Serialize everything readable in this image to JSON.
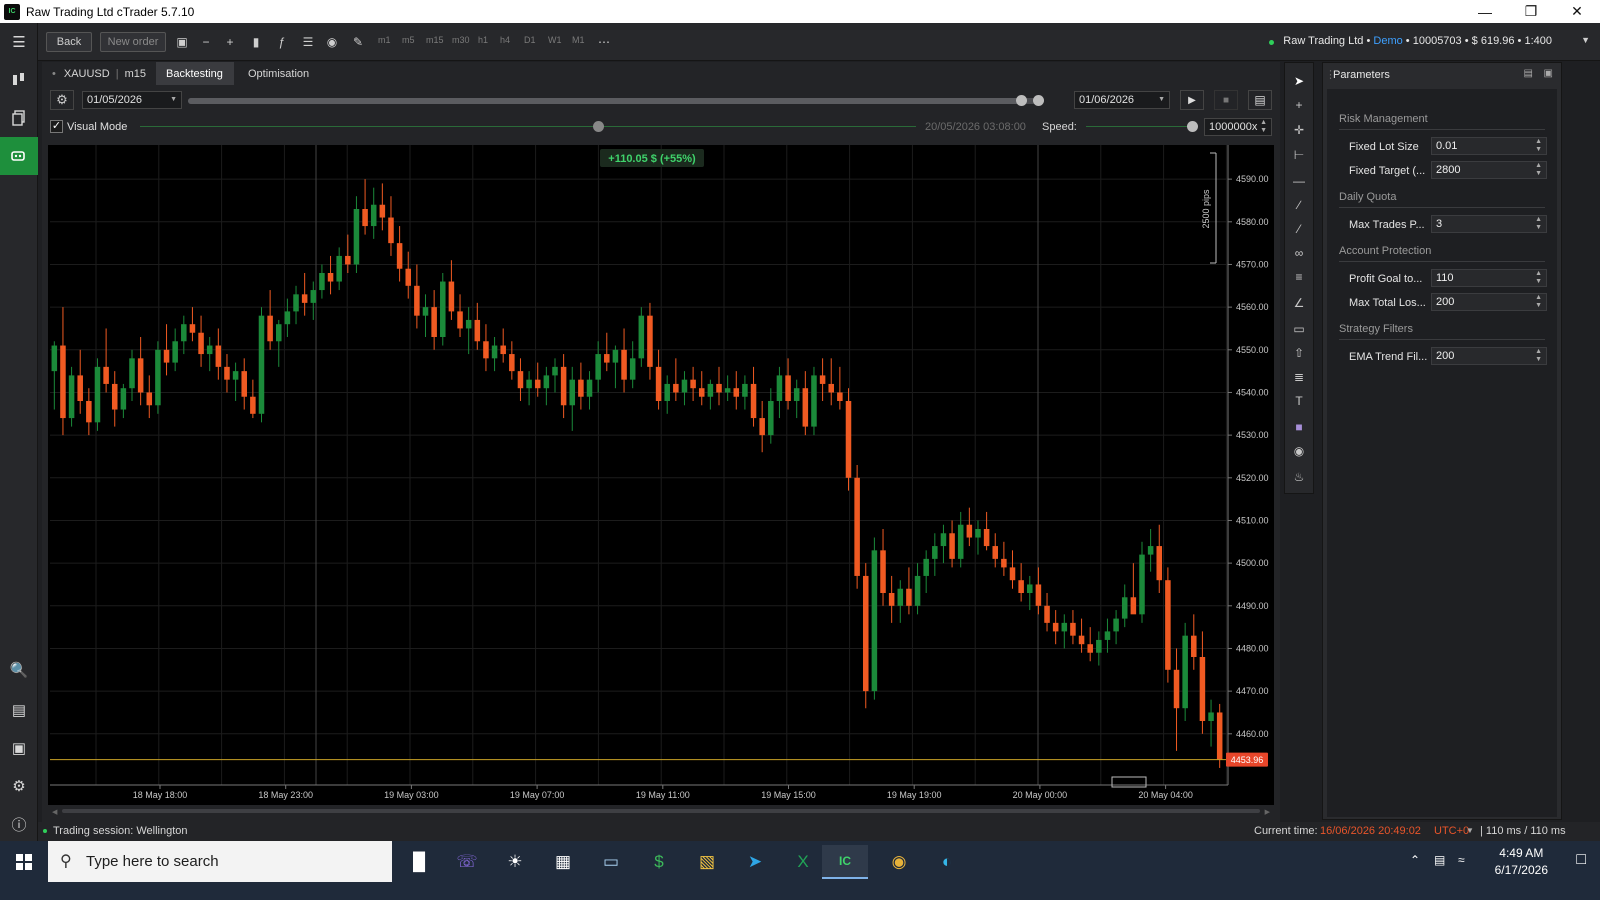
{
  "window": {
    "title": "Raw Trading Ltd cTrader 5.7.10",
    "app_icon_text": "IC"
  },
  "toolbar": {
    "back_label": "Back",
    "new_order_label": "New order",
    "timeframes": [
      "m1",
      "m5",
      "m15",
      "m30",
      "h1",
      "h4",
      "D1",
      "W1",
      "M1"
    ],
    "account": {
      "broker": "Raw Trading Ltd",
      "separator": "•",
      "type": "Demo",
      "number": "10005703",
      "balance": "$ 619.96",
      "leverage": "1:400"
    }
  },
  "tabs": {
    "symbol": "XAUUSD",
    "timeframe": "m15",
    "backtesting": "Backtesting",
    "optimisation": "Optimisation"
  },
  "backtest": {
    "start_date": "01/05/2026",
    "end_date": "01/06/2026",
    "visual_mode_label": "Visual Mode",
    "visual_mode_checked": true,
    "current_sim_time": "20/05/2026 03:08:00",
    "speed_label": "Speed:",
    "speed_value": "1000000x",
    "progress": 0.98,
    "visual_progress": 0.59
  },
  "chart_data": {
    "type": "candlestick",
    "symbol": "XAUUSD",
    "timeframe": "m15",
    "pnl_badge": "+110.05 $ (+55%)",
    "ruler_label": "2500 pips",
    "current_price": "4453.96",
    "ylim": [
      4448,
      4598
    ],
    "y_ticks": [
      "4590.00",
      "4580.00",
      "4570.00",
      "4560.00",
      "4550.00",
      "4540.00",
      "4530.00",
      "4520.00",
      "4510.00",
      "4500.00",
      "4490.00",
      "4480.00",
      "4470.00",
      "4460.00"
    ],
    "x_ticks": [
      "18 May 18:00",
      "18 May 23:00",
      "19 May 03:00",
      "19 May 07:00",
      "19 May 11:00",
      "19 May 15:00",
      "19 May 19:00",
      "20 May 00:00",
      "20 May 04:00"
    ],
    "colors": {
      "up": "#1b8a3a",
      "down": "#f05a22",
      "background": "#000000",
      "price_line": "#c9a227"
    },
    "candles": [
      {
        "o": 4545,
        "h": 4552,
        "l": 4536,
        "c": 4551
      },
      {
        "o": 4551,
        "h": 4560,
        "l": 4530,
        "c": 4534
      },
      {
        "o": 4534,
        "h": 4546,
        "l": 4532,
        "c": 4544
      },
      {
        "o": 4544,
        "h": 4550,
        "l": 4535,
        "c": 4538
      },
      {
        "o": 4538,
        "h": 4541,
        "l": 4530,
        "c": 4533
      },
      {
        "o": 4533,
        "h": 4548,
        "l": 4531,
        "c": 4546
      },
      {
        "o": 4546,
        "h": 4555,
        "l": 4540,
        "c": 4542
      },
      {
        "o": 4542,
        "h": 4545,
        "l": 4532,
        "c": 4536
      },
      {
        "o": 4536,
        "h": 4542,
        "l": 4534,
        "c": 4541
      },
      {
        "o": 4541,
        "h": 4550,
        "l": 4538,
        "c": 4548
      },
      {
        "o": 4548,
        "h": 4553,
        "l": 4537,
        "c": 4540
      },
      {
        "o": 4540,
        "h": 4544,
        "l": 4534,
        "c": 4537
      },
      {
        "o": 4537,
        "h": 4552,
        "l": 4535,
        "c": 4550
      },
      {
        "o": 4550,
        "h": 4556,
        "l": 4544,
        "c": 4547
      },
      {
        "o": 4547,
        "h": 4555,
        "l": 4545,
        "c": 4552
      },
      {
        "o": 4552,
        "h": 4558,
        "l": 4549,
        "c": 4556
      },
      {
        "o": 4556,
        "h": 4560,
        "l": 4552,
        "c": 4554
      },
      {
        "o": 4554,
        "h": 4558,
        "l": 4546,
        "c": 4549
      },
      {
        "o": 4549,
        "h": 4553,
        "l": 4545,
        "c": 4551
      },
      {
        "o": 4551,
        "h": 4555,
        "l": 4543,
        "c": 4546
      },
      {
        "o": 4546,
        "h": 4549,
        "l": 4540,
        "c": 4543
      },
      {
        "o": 4543,
        "h": 4547,
        "l": 4538,
        "c": 4545
      },
      {
        "o": 4545,
        "h": 4548,
        "l": 4536,
        "c": 4539
      },
      {
        "o": 4539,
        "h": 4543,
        "l": 4534,
        "c": 4535
      },
      {
        "o": 4535,
        "h": 4560,
        "l": 4533,
        "c": 4558
      },
      {
        "o": 4558,
        "h": 4564,
        "l": 4550,
        "c": 4552
      },
      {
        "o": 4552,
        "h": 4557,
        "l": 4546,
        "c": 4556
      },
      {
        "o": 4556,
        "h": 4562,
        "l": 4553,
        "c": 4559
      },
      {
        "o": 4559,
        "h": 4565,
        "l": 4556,
        "c": 4563
      },
      {
        "o": 4563,
        "h": 4568,
        "l": 4558,
        "c": 4561
      },
      {
        "o": 4561,
        "h": 4566,
        "l": 4557,
        "c": 4564
      },
      {
        "o": 4564,
        "h": 4570,
        "l": 4562,
        "c": 4568
      },
      {
        "o": 4568,
        "h": 4572,
        "l": 4563,
        "c": 4566
      },
      {
        "o": 4566,
        "h": 4574,
        "l": 4564,
        "c": 4572
      },
      {
        "o": 4572,
        "h": 4577,
        "l": 4568,
        "c": 4570
      },
      {
        "o": 4570,
        "h": 4586,
        "l": 4568,
        "c": 4583
      },
      {
        "o": 4583,
        "h": 4590,
        "l": 4577,
        "c": 4579
      },
      {
        "o": 4579,
        "h": 4588,
        "l": 4576,
        "c": 4584
      },
      {
        "o": 4584,
        "h": 4589,
        "l": 4578,
        "c": 4581
      },
      {
        "o": 4581,
        "h": 4586,
        "l": 4572,
        "c": 4575
      },
      {
        "o": 4575,
        "h": 4579,
        "l": 4566,
        "c": 4569
      },
      {
        "o": 4569,
        "h": 4573,
        "l": 4562,
        "c": 4565
      },
      {
        "o": 4565,
        "h": 4570,
        "l": 4555,
        "c": 4558
      },
      {
        "o": 4558,
        "h": 4563,
        "l": 4553,
        "c": 4560
      },
      {
        "o": 4560,
        "h": 4564,
        "l": 4550,
        "c": 4553
      },
      {
        "o": 4553,
        "h": 4568,
        "l": 4551,
        "c": 4566
      },
      {
        "o": 4566,
        "h": 4571,
        "l": 4557,
        "c": 4559
      },
      {
        "o": 4559,
        "h": 4563,
        "l": 4553,
        "c": 4555
      },
      {
        "o": 4555,
        "h": 4560,
        "l": 4549,
        "c": 4557
      },
      {
        "o": 4557,
        "h": 4561,
        "l": 4550,
        "c": 4552
      },
      {
        "o": 4552,
        "h": 4556,
        "l": 4545,
        "c": 4548
      },
      {
        "o": 4548,
        "h": 4553,
        "l": 4545,
        "c": 4551
      },
      {
        "o": 4551,
        "h": 4555,
        "l": 4547,
        "c": 4549
      },
      {
        "o": 4549,
        "h": 4552,
        "l": 4543,
        "c": 4545
      },
      {
        "o": 4545,
        "h": 4548,
        "l": 4538,
        "c": 4541
      },
      {
        "o": 4541,
        "h": 4545,
        "l": 4537,
        "c": 4543
      },
      {
        "o": 4543,
        "h": 4547,
        "l": 4539,
        "c": 4541
      },
      {
        "o": 4541,
        "h": 4546,
        "l": 4537,
        "c": 4544
      },
      {
        "o": 4544,
        "h": 4548,
        "l": 4540,
        "c": 4546
      },
      {
        "o": 4546,
        "h": 4549,
        "l": 4534,
        "c": 4537
      },
      {
        "o": 4537,
        "h": 4546,
        "l": 4531,
        "c": 4543
      },
      {
        "o": 4543,
        "h": 4547,
        "l": 4536,
        "c": 4539
      },
      {
        "o": 4539,
        "h": 4545,
        "l": 4536,
        "c": 4543
      },
      {
        "o": 4543,
        "h": 4552,
        "l": 4540,
        "c": 4549
      },
      {
        "o": 4549,
        "h": 4554,
        "l": 4545,
        "c": 4547
      },
      {
        "o": 4547,
        "h": 4551,
        "l": 4541,
        "c": 4550
      },
      {
        "o": 4550,
        "h": 4555,
        "l": 4540,
        "c": 4543
      },
      {
        "o": 4543,
        "h": 4552,
        "l": 4541,
        "c": 4548
      },
      {
        "o": 4548,
        "h": 4560,
        "l": 4546,
        "c": 4558
      },
      {
        "o": 4558,
        "h": 4561,
        "l": 4543,
        "c": 4546
      },
      {
        "o": 4546,
        "h": 4550,
        "l": 4536,
        "c": 4538
      },
      {
        "o": 4538,
        "h": 4544,
        "l": 4535,
        "c": 4542
      },
      {
        "o": 4542,
        "h": 4548,
        "l": 4538,
        "c": 4540
      },
      {
        "o": 4540,
        "h": 4545,
        "l": 4537,
        "c": 4543
      },
      {
        "o": 4543,
        "h": 4546,
        "l": 4538,
        "c": 4541
      },
      {
        "o": 4541,
        "h": 4545,
        "l": 4537,
        "c": 4539
      },
      {
        "o": 4539,
        "h": 4543,
        "l": 4536,
        "c": 4542
      },
      {
        "o": 4542,
        "h": 4546,
        "l": 4537,
        "c": 4540
      },
      {
        "o": 4540,
        "h": 4544,
        "l": 4538,
        "c": 4541
      },
      {
        "o": 4541,
        "h": 4545,
        "l": 4536,
        "c": 4539
      },
      {
        "o": 4539,
        "h": 4544,
        "l": 4536,
        "c": 4542
      },
      {
        "o": 4542,
        "h": 4546,
        "l": 4532,
        "c": 4534
      },
      {
        "o": 4534,
        "h": 4538,
        "l": 4526,
        "c": 4530
      },
      {
        "o": 4530,
        "h": 4541,
        "l": 4528,
        "c": 4538
      },
      {
        "o": 4538,
        "h": 4546,
        "l": 4534,
        "c": 4544
      },
      {
        "o": 4544,
        "h": 4548,
        "l": 4536,
        "c": 4538
      },
      {
        "o": 4538,
        "h": 4543,
        "l": 4534,
        "c": 4541
      },
      {
        "o": 4541,
        "h": 4545,
        "l": 4530,
        "c": 4532
      },
      {
        "o": 4532,
        "h": 4546,
        "l": 4530,
        "c": 4544
      },
      {
        "o": 4544,
        "h": 4548,
        "l": 4538,
        "c": 4542
      },
      {
        "o": 4542,
        "h": 4548,
        "l": 4537,
        "c": 4540
      },
      {
        "o": 4540,
        "h": 4546,
        "l": 4536,
        "c": 4538
      },
      {
        "o": 4538,
        "h": 4541,
        "l": 4517,
        "c": 4520
      },
      {
        "o": 4520,
        "h": 4523,
        "l": 4494,
        "c": 4497
      },
      {
        "o": 4497,
        "h": 4500,
        "l": 4466,
        "c": 4470
      },
      {
        "o": 4470,
        "h": 4506,
        "l": 4468,
        "c": 4503
      },
      {
        "o": 4503,
        "h": 4508,
        "l": 4490,
        "c": 4493
      },
      {
        "o": 4493,
        "h": 4497,
        "l": 4486,
        "c": 4490
      },
      {
        "o": 4490,
        "h": 4496,
        "l": 4486,
        "c": 4494
      },
      {
        "o": 4494,
        "h": 4499,
        "l": 4488,
        "c": 4490
      },
      {
        "o": 4490,
        "h": 4500,
        "l": 4488,
        "c": 4497
      },
      {
        "o": 4497,
        "h": 4503,
        "l": 4493,
        "c": 4501
      },
      {
        "o": 4501,
        "h": 4507,
        "l": 4497,
        "c": 4504
      },
      {
        "o": 4504,
        "h": 4509,
        "l": 4500,
        "c": 4507
      },
      {
        "o": 4507,
        "h": 4510,
        "l": 4499,
        "c": 4501
      },
      {
        "o": 4501,
        "h": 4512,
        "l": 4499,
        "c": 4509
      },
      {
        "o": 4509,
        "h": 4513,
        "l": 4504,
        "c": 4506
      },
      {
        "o": 4506,
        "h": 4510,
        "l": 4502,
        "c": 4508
      },
      {
        "o": 4508,
        "h": 4512,
        "l": 4503,
        "c": 4504
      },
      {
        "o": 4504,
        "h": 4507,
        "l": 4499,
        "c": 4501
      },
      {
        "o": 4501,
        "h": 4505,
        "l": 4497,
        "c": 4499
      },
      {
        "o": 4499,
        "h": 4503,
        "l": 4494,
        "c": 4496
      },
      {
        "o": 4496,
        "h": 4500,
        "l": 4491,
        "c": 4493
      },
      {
        "o": 4493,
        "h": 4497,
        "l": 4489,
        "c": 4495
      },
      {
        "o": 4495,
        "h": 4499,
        "l": 4488,
        "c": 4490
      },
      {
        "o": 4490,
        "h": 4493,
        "l": 4484,
        "c": 4486
      },
      {
        "o": 4486,
        "h": 4489,
        "l": 4481,
        "c": 4484
      },
      {
        "o": 4484,
        "h": 4488,
        "l": 4480,
        "c": 4486
      },
      {
        "o": 4486,
        "h": 4489,
        "l": 4481,
        "c": 4483
      },
      {
        "o": 4483,
        "h": 4487,
        "l": 4479,
        "c": 4481
      },
      {
        "o": 4481,
        "h": 4485,
        "l": 4477,
        "c": 4479
      },
      {
        "o": 4479,
        "h": 4484,
        "l": 4476,
        "c": 4482
      },
      {
        "o": 4482,
        "h": 4487,
        "l": 4479,
        "c": 4484
      },
      {
        "o": 4484,
        "h": 4489,
        "l": 4481,
        "c": 4487
      },
      {
        "o": 4487,
        "h": 4495,
        "l": 4485,
        "c": 4492
      },
      {
        "o": 4492,
        "h": 4500,
        "l": 4490,
        "c": 4488
      },
      {
        "o": 4488,
        "h": 4505,
        "l": 4486,
        "c": 4502
      },
      {
        "o": 4502,
        "h": 4508,
        "l": 4498,
        "c": 4504
      },
      {
        "o": 4504,
        "h": 4509,
        "l": 4493,
        "c": 4496
      },
      {
        "o": 4496,
        "h": 4499,
        "l": 4472,
        "c": 4475
      },
      {
        "o": 4475,
        "h": 4480,
        "l": 4456,
        "c": 4466
      },
      {
        "o": 4466,
        "h": 4486,
        "l": 4463,
        "c": 4483
      },
      {
        "o": 4483,
        "h": 4488,
        "l": 4475,
        "c": 4478
      },
      {
        "o": 4478,
        "h": 4484,
        "l": 4460,
        "c": 4463
      },
      {
        "o": 4463,
        "h": 4468,
        "l": 4457,
        "c": 4465
      },
      {
        "o": 4465,
        "h": 4467,
        "l": 4452,
        "c": 4454
      }
    ]
  },
  "parameters": {
    "title": "Parameters",
    "groups": [
      {
        "title": "Risk Management",
        "params": [
          {
            "label": "Fixed Lot Size",
            "value": "0.01"
          },
          {
            "label": "Fixed Target (...",
            "value": "2800"
          }
        ]
      },
      {
        "title": "Daily Quota",
        "params": [
          {
            "label": "Max Trades P...",
            "value": "3"
          }
        ]
      },
      {
        "title": "Account Protection",
        "params": [
          {
            "label": "Profit Goal to...",
            "value": "110"
          },
          {
            "label": "Max Total Los...",
            "value": "200"
          }
        ]
      },
      {
        "title": "Strategy Filters",
        "params": [
          {
            "label": "EMA Trend Fil...",
            "value": "200"
          }
        ]
      }
    ]
  },
  "statusbar": {
    "session": "Trading session: Wellington",
    "current_time_label": "Current time:",
    "current_time": "16/06/2026 20:49:02",
    "timezone": "UTC+0",
    "latency": "| 110 ms / 110 ms"
  },
  "taskbar": {
    "search_placeholder": "Type here to search",
    "time": "4:49 AM",
    "date": "6/17/2026"
  }
}
